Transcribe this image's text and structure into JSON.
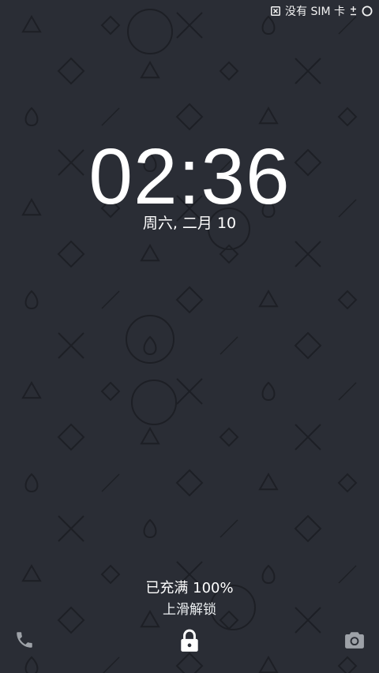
{
  "status_bar": {
    "carrier_text": "没有 SIM 卡",
    "sim_icon": "no-sim-icon",
    "data_icon": "data-updown-icon",
    "battery_icon": "battery-circle-icon"
  },
  "lockscreen": {
    "time": "02:36",
    "date": "周六, 二月 10",
    "charging_status": "已充满 100%",
    "unlock_hint": "上滑解锁"
  },
  "shortcuts": {
    "left_icon": "phone-icon",
    "center_icon": "lock-icon",
    "right_icon": "camera-icon"
  },
  "colors": {
    "background": "#2a2d35",
    "pattern": "#1d1f25",
    "text": "#ffffff",
    "icon_muted": "#9ea2a8"
  }
}
